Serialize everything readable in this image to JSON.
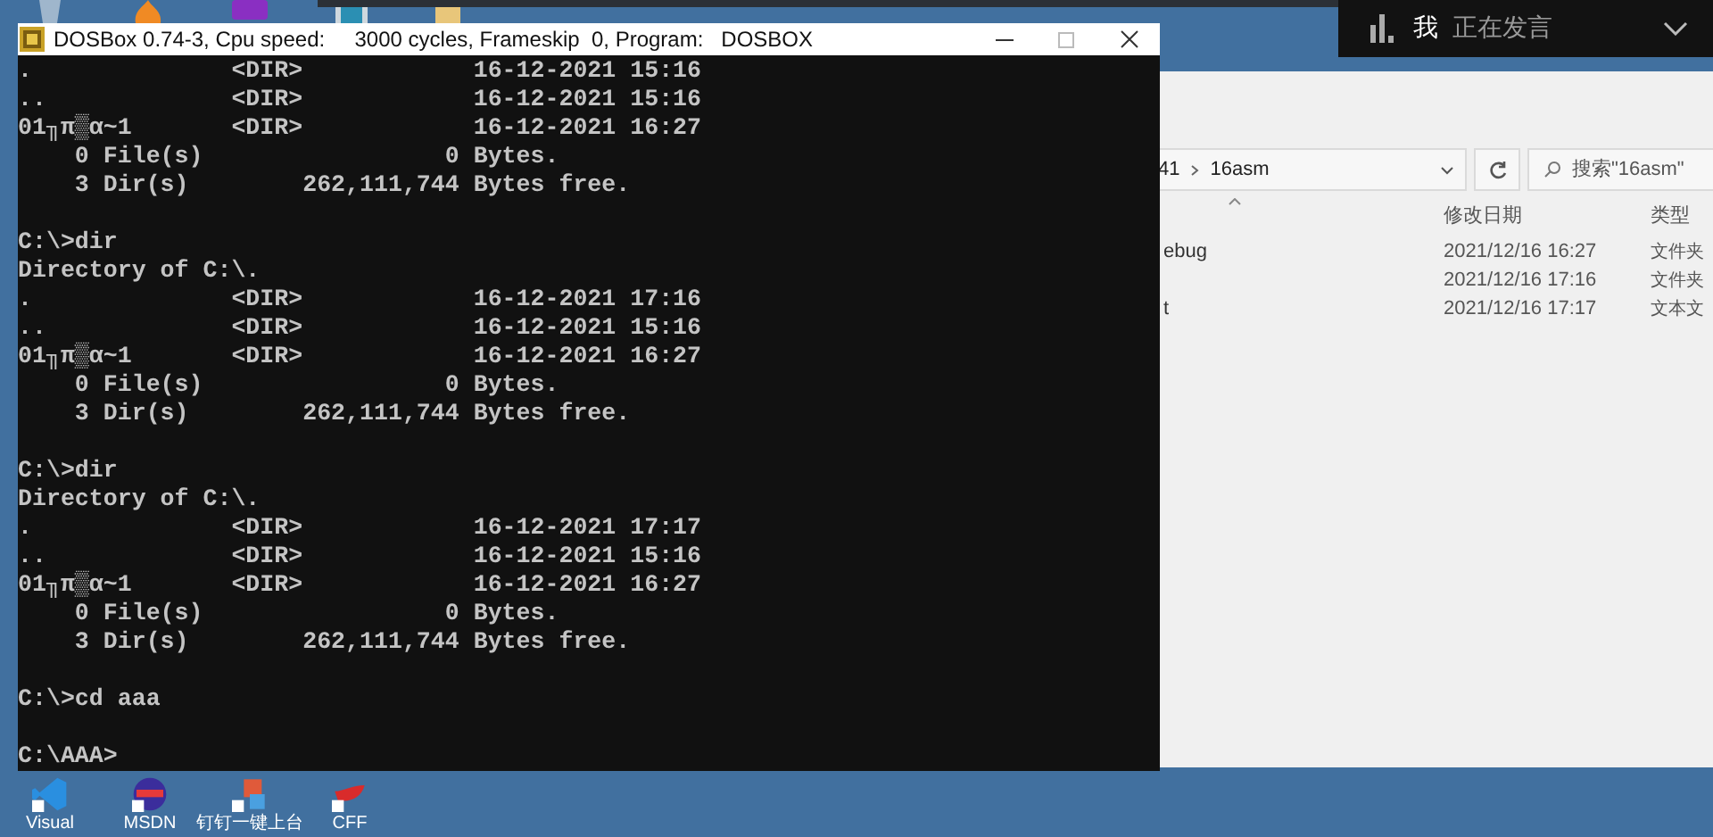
{
  "top_icons": [
    {
      "kind": "trash"
    },
    {
      "kind": "flame"
    },
    {
      "kind": "hex"
    },
    {
      "kind": "monitor"
    },
    {
      "kind": "folder"
    }
  ],
  "meeting_bar": {
    "user": "我",
    "status": "正在发言"
  },
  "explorer": {
    "breadcrumb": [
      "41",
      "16asm"
    ],
    "search": {
      "placeholder": "搜索\"16asm\""
    },
    "columns": [
      "修改日期",
      "类型"
    ],
    "rows": [
      {
        "name": "ebug",
        "date": "2021/12/16 16:27",
        "type": "文件夹"
      },
      {
        "date": "2021/12/16 17:16",
        "type": "文件夹"
      },
      {
        "name": "t",
        "date": "2021/12/16 17:17",
        "type": "文本文"
      }
    ]
  },
  "dosbox": {
    "title": "DOSBox 0.74-3, Cpu speed:     3000 cycles, Frameskip  0, Program:   DOSBOX",
    "blocks": [
      [
        ".              <DIR>            16-12-2021 15:16",
        "..             <DIR>            16-12-2021 15:16",
        "01╖π▒α~1       <DIR>            16-12-2021 16:27",
        "    0 File(s)                 0 Bytes.",
        "    3 Dir(s)        262,111,744 Bytes free."
      ],
      [
        "C:\\>dir",
        "Directory of C:\\.",
        ".              <DIR>            16-12-2021 17:16",
        "..             <DIR>            16-12-2021 15:16",
        "01╖π▒α~1       <DIR>            16-12-2021 16:27",
        "    0 File(s)                 0 Bytes.",
        "    3 Dir(s)        262,111,744 Bytes free."
      ],
      [
        "C:\\>dir",
        "Directory of C:\\.",
        ".              <DIR>            16-12-2021 17:17",
        "..             <DIR>            16-12-2021 15:16",
        "01╖π▒α~1       <DIR>            16-12-2021 16:27",
        "    0 File(s)                 0 Bytes.",
        "    3 Dir(s)        262,111,744 Bytes free."
      ],
      [
        "C:\\>cd aaa"
      ],
      [
        "C:\\AAA>"
      ]
    ]
  },
  "desktop_icons": [
    {
      "label": "Visual",
      "kind": "vscode"
    },
    {
      "label": "MSDN",
      "kind": "msdn"
    },
    {
      "label": "钉钉一键上台",
      "kind": "dingtalk"
    },
    {
      "label": "CFF",
      "kind": "cff"
    }
  ]
}
